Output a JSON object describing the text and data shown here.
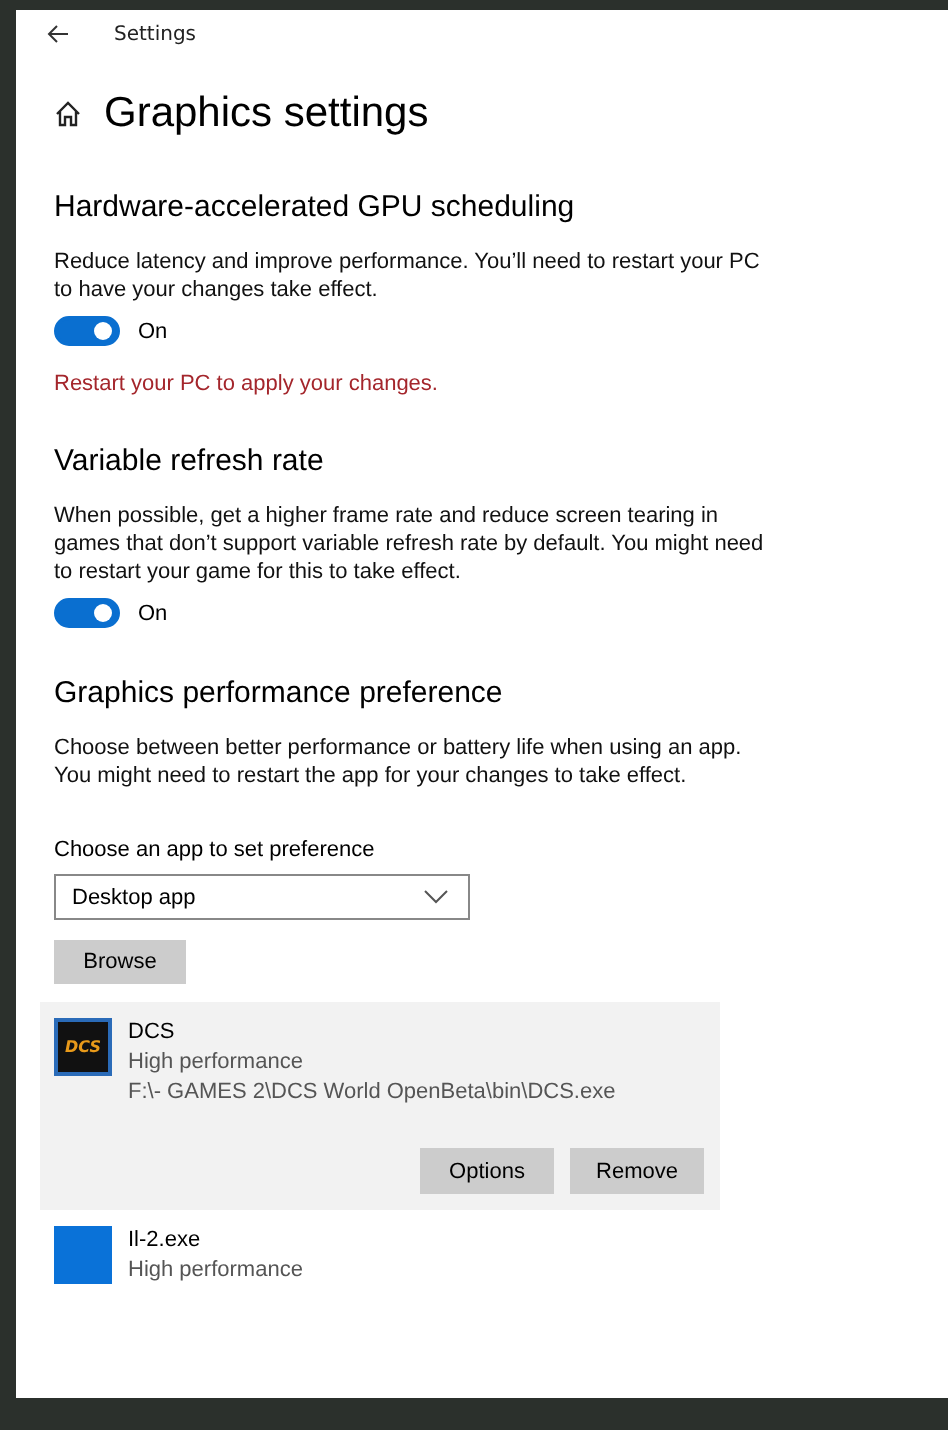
{
  "window": {
    "title": "Settings"
  },
  "page_title": "Graphics settings",
  "sections": [
    {
      "heading": "Hardware-accelerated GPU scheduling",
      "description": "Reduce latency and improve performance. You’ll need to restart your PC to have your changes take effect.",
      "toggle": {
        "on": true,
        "label": "On"
      },
      "warning": "Restart your PC to apply your changes."
    },
    {
      "heading": "Variable refresh rate",
      "description": "When possible, get a higher frame rate and reduce screen tearing in games that don’t support variable refresh rate by default. You might need to restart your game for this to take effect.",
      "toggle": {
        "on": true,
        "label": "On"
      }
    },
    {
      "heading": "Graphics performance preference",
      "description": "Choose between better performance or battery life when using an app. You might need to restart the app for your changes to take effect."
    }
  ],
  "app_picker": {
    "label": "Choose an app to set preference",
    "dropdown": {
      "value": "Desktop app"
    },
    "browse_button": "Browse"
  },
  "apps": [
    {
      "name": "DCS",
      "preference": "High performance",
      "path": "F:\\- GAMES 2\\DCS World OpenBeta\\bin\\DCS.exe",
      "kind": "logo",
      "icon_text": "DCS",
      "selected": true,
      "buttons": [
        "Options",
        "Remove"
      ]
    },
    {
      "name": "Il-2.exe",
      "preference": "High performance",
      "kind": "plain",
      "selected": false
    }
  ]
}
